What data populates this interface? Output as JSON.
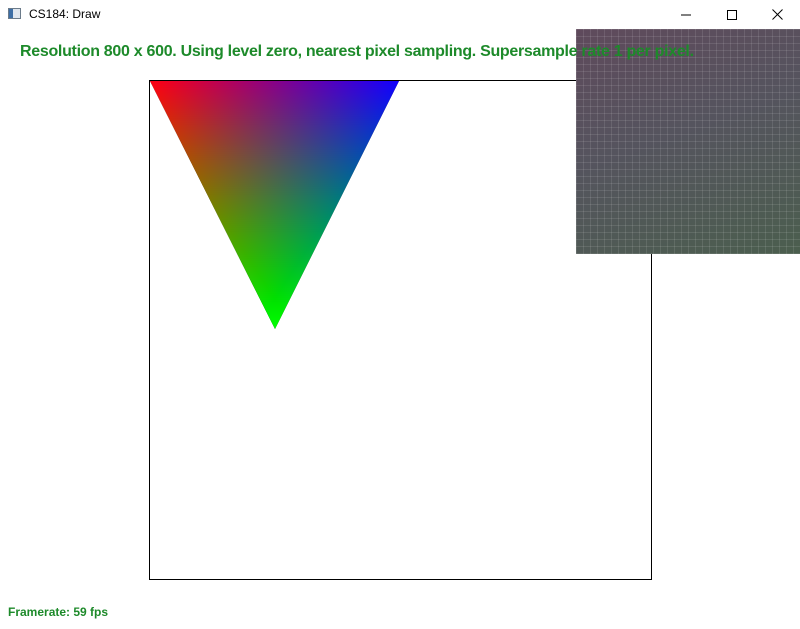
{
  "window": {
    "title": "CS184: Draw",
    "icon": "app-window-icon",
    "controls": {
      "minimize": "minimize-icon",
      "maximize": "maximize-icon",
      "close": "close-icon"
    }
  },
  "overlay": {
    "status_text": "Resolution 800 x 600. Using level zero, nearest pixel sampling. Supersample rate 1 per pixel.",
    "framerate_text": "Framerate: 59 fps"
  },
  "scene": {
    "background": "#ffffff",
    "frame_color": "#000000",
    "text_color": "#1d8a2a",
    "triangle": {
      "vertex_colors": [
        "#ff0000",
        "#0000ff",
        "#00ff00"
      ]
    },
    "zoom_panel_colors": [
      "#5f4a5c",
      "#55545e",
      "#4b5e4e"
    ]
  }
}
